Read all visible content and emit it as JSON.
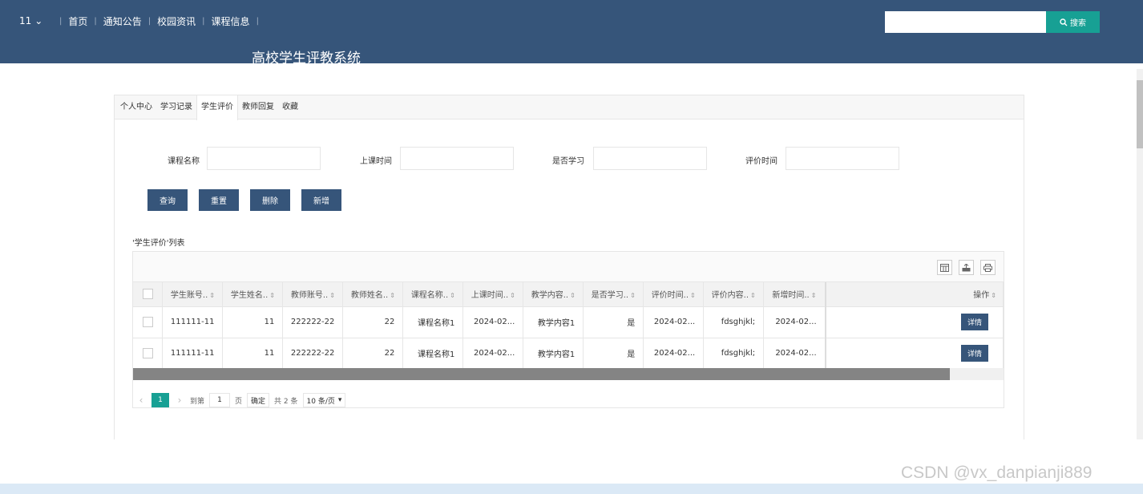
{
  "header": {
    "user": "11",
    "nav": [
      "首页",
      "通知公告",
      "校园资讯",
      "课程信息"
    ],
    "search_placeholder": "",
    "search_label": "搜索",
    "site_title": "高校学生评教系统"
  },
  "tabs": [
    {
      "label": "个人中心",
      "active": false
    },
    {
      "label": "学习记录",
      "active": false
    },
    {
      "label": "学生评价",
      "active": true
    },
    {
      "label": "教师回复",
      "active": false
    },
    {
      "label": "收藏",
      "active": false
    }
  ],
  "filters": [
    {
      "label": "课程名称",
      "value": ""
    },
    {
      "label": "上课时间",
      "value": ""
    },
    {
      "label": "是否学习",
      "value": ""
    },
    {
      "label": "评价时间",
      "value": ""
    }
  ],
  "buttons": {
    "query": "查询",
    "reset": "重置",
    "delete": "删除",
    "add": "新增"
  },
  "list_title": "'学生评价'列表",
  "table": {
    "columns": [
      "学生账号..",
      "学生姓名..",
      "教师账号..",
      "教师姓名..",
      "课程名称..",
      "上课时间..",
      "教学内容..",
      "是否学习..",
      "评价时间..",
      "评价内容..",
      "新增时间..",
      "操作"
    ],
    "rows": [
      [
        "111111-11",
        "11",
        "222222-22",
        "22",
        "课程名称1",
        "2024-02...",
        "教学内容1",
        "是",
        "2024-02...",
        "fdsghjkl;",
        "2024-02..."
      ],
      [
        "111111-11",
        "11",
        "222222-22",
        "22",
        "课程名称1",
        "2024-02...",
        "教学内容1",
        "是",
        "2024-02...",
        "fdsghjkl;",
        "2024-02..."
      ]
    ],
    "action_label": "详情"
  },
  "pager": {
    "current": "1",
    "goto_label": "到第",
    "page_input": "1",
    "page_unit": "页",
    "confirm": "确定",
    "total": "共 2 条",
    "page_size": "10 条/页"
  },
  "watermark": "CSDN @vx_danpianji889",
  "colors": {
    "header_bg": "#36557a",
    "accent": "#17a094",
    "button": "#36557a"
  }
}
